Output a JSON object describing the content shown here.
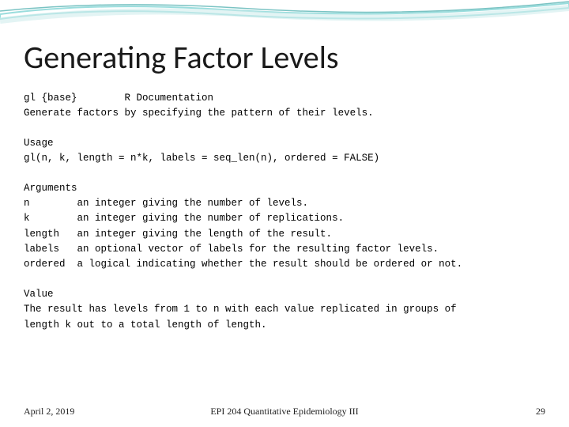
{
  "title": "Generating Factor Levels",
  "block1": "gl {base}        R Documentation\nGenerate factors by specifying the pattern of their levels.",
  "block2": "Usage\ngl(n, k, length = n*k, labels = seq_len(n), ordered = FALSE)",
  "block3": "Arguments\nn        an integer giving the number of levels.\nk        an integer giving the number of replications.\nlength   an integer giving the length of the result.\nlabels   an optional vector of labels for the resulting factor levels.\nordered  a logical indicating whether the result should be ordered or not.",
  "block4": "Value\nThe result has levels from 1 to n with each value replicated in groups of\nlength k out to a total length of length.",
  "footer": {
    "date": "April 2, 2019",
    "course": "EPI 204 Quantitative Epidemiology III",
    "page": "29"
  }
}
